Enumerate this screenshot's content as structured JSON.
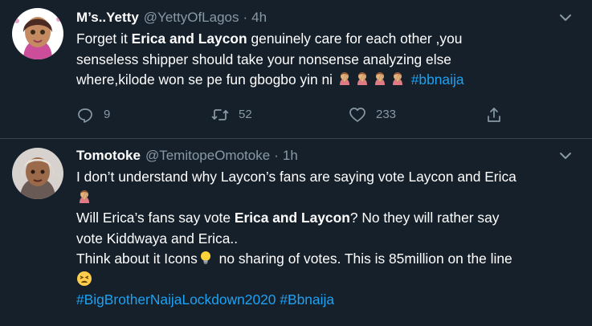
{
  "tweets": [
    {
      "display_name": "M’s..Yetty",
      "handle": "@YettyOfLagos",
      "separator": "·",
      "time": "4h",
      "line1_a": "Forget it ",
      "line1_bold": "Erica and Laycon",
      "line1_b": " genuinely care for each other ,you",
      "line2": "senseless shipper should take your nonsense analyzing else",
      "line3": "where,kilode won se pe fun gbogbo yin ni ",
      "hashtag": "#bbnaija",
      "reply_count": "9",
      "retweet_count": "52",
      "like_count": "233"
    },
    {
      "display_name": "Tomotoke",
      "handle": "@TemitopeOmotoke",
      "separator": "·",
      "time": "1h",
      "line1": "I don’t understand why Laycon’s fans are saying vote Laycon and Erica",
      "line3_a": "Will Erica’s fans say vote ",
      "line3_bold": "Erica and Laycon",
      "line3_b": "? No they will rather say",
      "line4": "vote Kiddwaya and Erica..",
      "line5_a": "Think about it Icons",
      "line5_b": " no sharing of votes. This is 85million on the line",
      "hashtag_1": "#BigBrotherNaijaLockdown2020",
      "hashtag_2": "#Bbnaija"
    }
  ],
  "icons": [
    "facepalm-emoji",
    "lightbulb-emoji",
    "tired-face-emoji",
    "reply-icon",
    "retweet-icon",
    "like-icon",
    "share-icon",
    "chevron-down-icon"
  ],
  "colors": {
    "background": "#15202b",
    "text": "#ffffff",
    "muted": "#8899a6",
    "link": "#1da1f2",
    "divider": "#38444d"
  }
}
